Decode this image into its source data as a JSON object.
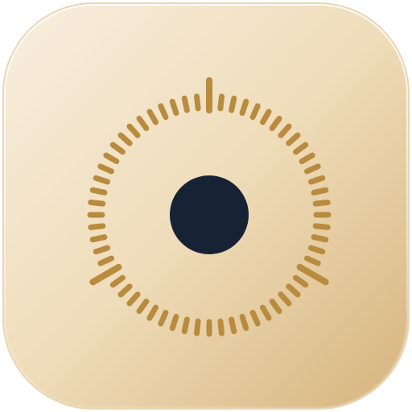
{
  "icon": {
    "name": "timer-dial-app-icon",
    "tile_gradient_start": "#f8efe0",
    "tile_gradient_mid": "#efdcb9",
    "tile_gradient_end": "#d6b47d",
    "tile_border": "#e8d6b4",
    "tick_color": "#b88b3f",
    "center_dot_color": "#172235",
    "tick_count": 60,
    "major_tick_angles_deg": [
      0,
      120,
      240
    ]
  }
}
